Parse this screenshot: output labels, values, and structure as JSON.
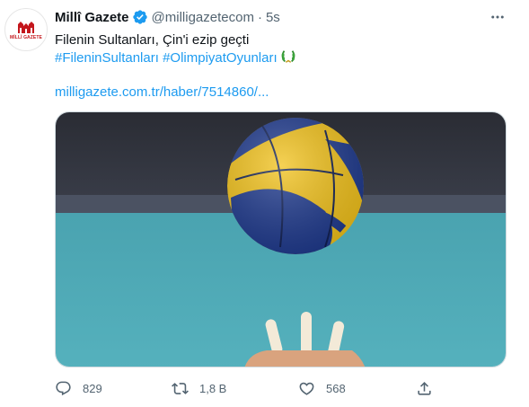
{
  "tweet": {
    "author": {
      "name": "Millî Gazete",
      "handle": "@milligazetecom",
      "avatar_text": "MİLLİ GAZETE",
      "verified_icon": "verified-badge-icon"
    },
    "separator": "·",
    "time": "5s",
    "text_line1": "Filenin Sultanları, Çin'i ezip geçti",
    "hashtags": [
      "#FileninSultanları",
      "#OlimpiyatOyunları"
    ],
    "link": "milligazete.com.tr/haber/7514860/...",
    "media_alt": "volleyball photo",
    "stats": {
      "replies": "829",
      "retweets": "1,8 B",
      "likes": "568"
    }
  },
  "colors": {
    "accent": "#1d9bf0",
    "secondary_text": "#536471",
    "brand_red": "#c4161c"
  },
  "icons": [
    "more-icon",
    "reply-icon",
    "retweet-icon",
    "like-icon",
    "share-icon",
    "wreath-emoji-icon"
  ]
}
